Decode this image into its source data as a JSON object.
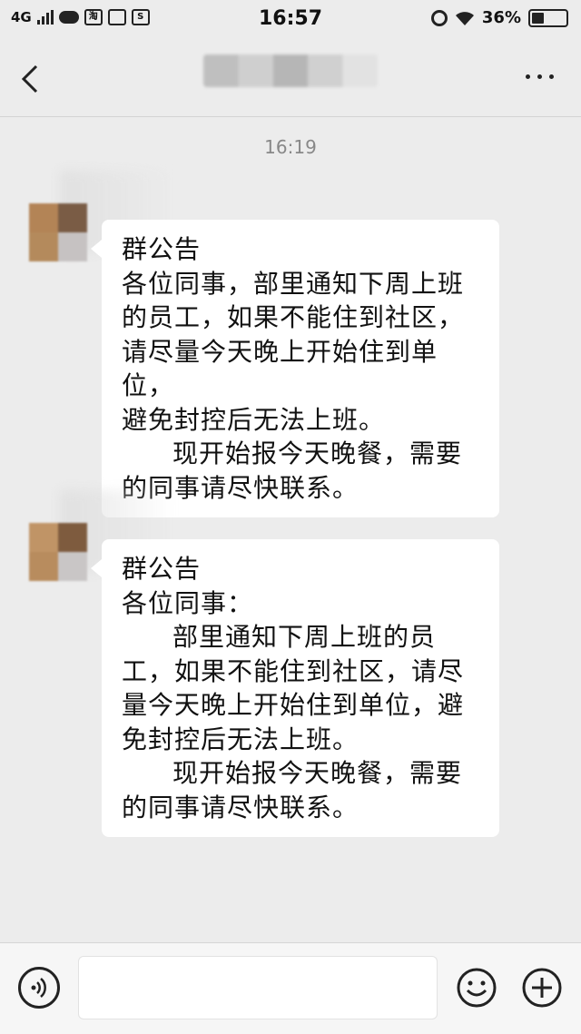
{
  "status_bar": {
    "network": "4G",
    "icon_taobao": "淘",
    "icon_s": "S",
    "time": "16:57",
    "battery": "36%",
    "battery_level": 0.36
  },
  "nav": {
    "back_icon": "chevron-left-icon",
    "more_icon": "more-dots-icon",
    "title_blurred": true
  },
  "chat": {
    "timestamp": "16:19",
    "messages": [
      {
        "lines": [
          {
            "text": "群公告",
            "indent": false
          },
          {
            "text": "各位同事，部里通知下周上班",
            "indent": false
          },
          {
            "text": "的员工，如果不能住到社区，",
            "indent": false
          },
          {
            "text": "请尽量今天晚上开始住到单位，",
            "indent": false
          },
          {
            "text": "避免封控后无法上班。",
            "indent": false
          },
          {
            "text": "现开始报今天晚餐，需要",
            "indent": true
          },
          {
            "text": "的同事请尽快联系。",
            "indent": false
          }
        ]
      },
      {
        "lines": [
          {
            "text": "群公告",
            "indent": false
          },
          {
            "text": "各位同事：",
            "indent": false
          },
          {
            "text": "部里通知下周上班的员",
            "indent": true
          },
          {
            "text": "工，如果不能住到社区，请尽",
            "indent": false
          },
          {
            "text": "量今天晚上开始住到单位，避",
            "indent": false
          },
          {
            "text": "免封控后无法上班。",
            "indent": false
          },
          {
            "text": "现开始报今天晚餐，需要",
            "indent": true
          },
          {
            "text": "的同事请尽快联系。",
            "indent": false
          }
        ]
      }
    ]
  },
  "input_bar": {
    "voice_icon": "voice-icon",
    "emoji_icon": "emoji-icon",
    "plus_icon": "plus-icon",
    "placeholder": ""
  }
}
